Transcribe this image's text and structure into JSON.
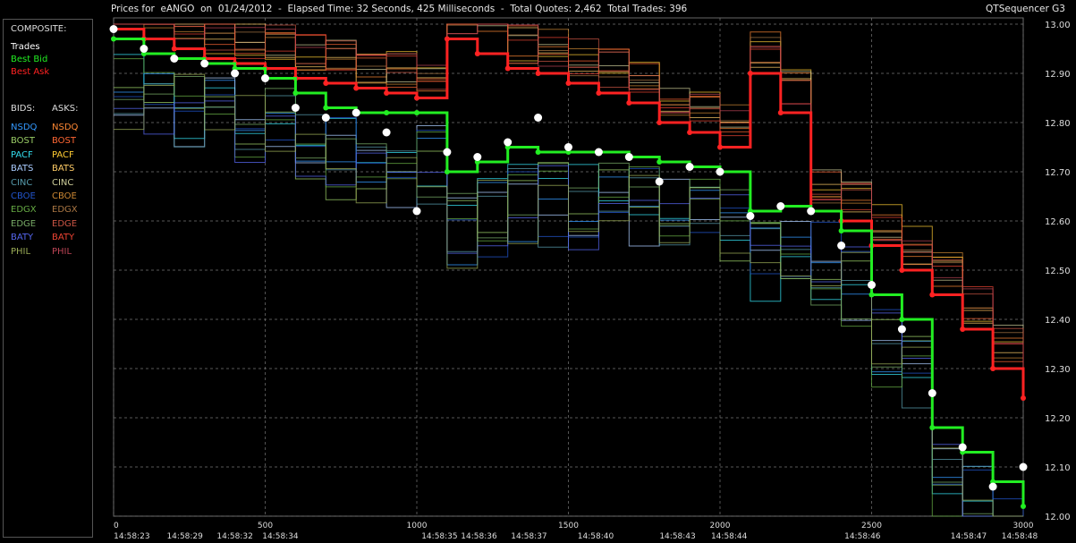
{
  "header": {
    "title": "Prices for  eANGO  on  01/24/2012  -  Elapsed Time: 32 Seconds, 425 Milliseconds  -  Total Quotes: 2,462  Total Trades: 396",
    "app_name": "QTSequencer G3"
  },
  "legend": {
    "composite_label": "COMPOSITE:",
    "composite": [
      {
        "label": "Trades",
        "color": "#ffffff"
      },
      {
        "label": "Best Bid",
        "color": "#22ee22"
      },
      {
        "label": "Best Ask",
        "color": "#ff2222"
      }
    ],
    "bids_label": "BIDS:",
    "asks_label": "ASKS:",
    "exchanges": [
      {
        "bid": "NSDQ",
        "ask": "NSDQ",
        "bid_color": "#3399ff",
        "ask_color": "#ff8833"
      },
      {
        "bid": "BOST",
        "ask": "BOST",
        "bid_color": "#99cc66",
        "ask_color": "#ff6633"
      },
      {
        "bid": "PACF",
        "ask": "PACF",
        "bid_color": "#33ddee",
        "ask_color": "#ffcc33"
      },
      {
        "bid": "BATS",
        "ask": "BATS",
        "bid_color": "#aaccff",
        "ask_color": "#ffcc66"
      },
      {
        "bid": "CINC",
        "ask": "CINC",
        "bid_color": "#5599aa",
        "ask_color": "#cccc99"
      },
      {
        "bid": "CBOE",
        "ask": "CBOE",
        "bid_color": "#2255cc",
        "ask_color": "#cc8833"
      },
      {
        "bid": "EDGX",
        "ask": "EDGX",
        "bid_color": "#66aa44",
        "ask_color": "#aa7744"
      },
      {
        "bid": "EDGE",
        "ask": "EDGE",
        "bid_color": "#77aa66",
        "ask_color": "#cc5544"
      },
      {
        "bid": "BATY",
        "ask": "BATY",
        "bid_color": "#5566ee",
        "ask_color": "#ee4433"
      },
      {
        "bid": "PHIL",
        "ask": "PHIL",
        "bid_color": "#99aa55",
        "ask_color": "#bb4455"
      }
    ]
  },
  "chart_data": {
    "type": "line",
    "x_range": [
      0,
      3000
    ],
    "y_range": [
      12.0,
      13.0
    ],
    "y_ticks": [
      "13.00",
      "12.90",
      "12.80",
      "12.70",
      "12.60",
      "12.50",
      "12.40",
      "12.30",
      "12.20",
      "12.10",
      "12.00"
    ],
    "x_ticks": [
      "0",
      "500",
      "1000",
      "1500",
      "2000",
      "2500",
      "3000"
    ],
    "x_tick_values": [
      0,
      500,
      1000,
      1500,
      2000,
      2500,
      3000
    ],
    "time_labels": [
      "14:58:23",
      "14:58:29",
      "14:58:32",
      "14:58:34",
      "14:58:35",
      "14:58:36",
      "14:58:37",
      "14:58:40",
      "14:58:43",
      "14:58:44",
      "14:58:46",
      "14:58:47",
      "14:58:48"
    ],
    "time_label_x": [
      60,
      235,
      400,
      550,
      1075,
      1205,
      1370,
      1590,
      1860,
      2030,
      2470,
      2820,
      2990
    ],
    "grid": true,
    "series": [
      {
        "name": "Best Ask",
        "color": "#ff2222",
        "x": [
          0,
          100,
          200,
          300,
          400,
          500,
          600,
          700,
          800,
          900,
          1000,
          1100,
          1200,
          1300,
          1400,
          1500,
          1600,
          1700,
          1800,
          1900,
          2000,
          2100,
          2200,
          2300,
          2400,
          2500,
          2600,
          2700,
          2800,
          2900,
          3000
        ],
        "values": [
          12.99,
          12.97,
          12.95,
          12.93,
          12.92,
          12.91,
          12.89,
          12.88,
          12.87,
          12.86,
          12.85,
          12.97,
          12.94,
          12.91,
          12.9,
          12.88,
          12.86,
          12.84,
          12.8,
          12.78,
          12.75,
          12.9,
          12.82,
          12.62,
          12.6,
          12.55,
          12.5,
          12.45,
          12.38,
          12.3,
          12.24
        ]
      },
      {
        "name": "Best Bid",
        "color": "#22ee22",
        "x": [
          0,
          100,
          200,
          300,
          400,
          500,
          600,
          700,
          800,
          900,
          1000,
          1100,
          1200,
          1300,
          1400,
          1500,
          1600,
          1700,
          1800,
          1900,
          2000,
          2100,
          2200,
          2300,
          2400,
          2500,
          2600,
          2700,
          2800,
          2900,
          3000
        ],
        "values": [
          12.97,
          12.94,
          12.93,
          12.92,
          12.91,
          12.89,
          12.86,
          12.83,
          12.82,
          12.82,
          12.82,
          12.7,
          12.72,
          12.75,
          12.74,
          12.74,
          12.74,
          12.73,
          12.72,
          12.71,
          12.7,
          12.62,
          12.63,
          12.62,
          12.58,
          12.45,
          12.4,
          12.18,
          12.13,
          12.07,
          12.02
        ]
      },
      {
        "name": "Trades",
        "color": "#ffffff",
        "x": [
          0,
          100,
          200,
          300,
          400,
          500,
          600,
          700,
          800,
          900,
          1000,
          1100,
          1200,
          1300,
          1400,
          1500,
          1600,
          1700,
          1800,
          1900,
          2000,
          2100,
          2200,
          2300,
          2400,
          2500,
          2600,
          2700,
          2800,
          2900,
          3000
        ],
        "values": [
          12.99,
          12.95,
          12.93,
          12.92,
          12.9,
          12.89,
          12.83,
          12.81,
          12.82,
          12.78,
          12.62,
          12.74,
          12.73,
          12.76,
          12.81,
          12.75,
          12.74,
          12.73,
          12.68,
          12.71,
          12.7,
          12.61,
          12.63,
          12.62,
          12.55,
          12.47,
          12.38,
          12.25,
          12.14,
          12.06,
          12.1
        ]
      }
    ]
  }
}
